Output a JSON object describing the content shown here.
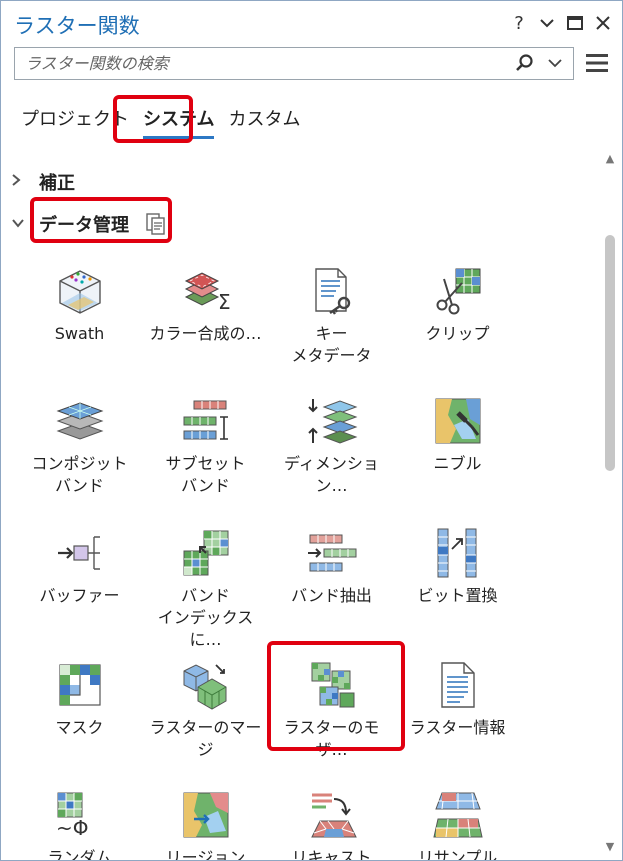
{
  "window": {
    "title": "ラスター関数",
    "help": "?",
    "collapse": "⌄",
    "maximize": "▭",
    "close": "✕"
  },
  "search": {
    "placeholder": "ラスター関数の検索"
  },
  "tabs": [
    {
      "label": "プロジェクト",
      "active": false
    },
    {
      "label": "システム",
      "active": true
    },
    {
      "label": "カスタム",
      "active": false
    }
  ],
  "groups": [
    {
      "label": "補正",
      "expanded": false
    },
    {
      "label": "データ管理",
      "expanded": true
    }
  ],
  "items": [
    {
      "label": "Swath",
      "icon": "swath-icon"
    },
    {
      "label": "カラー合成の…",
      "icon": "color-composite-icon"
    },
    {
      "label": "キー\nメタデータ",
      "icon": "key-metadata-icon"
    },
    {
      "label": "クリップ",
      "icon": "clip-icon"
    },
    {
      "label": "コンポジット\nバンド",
      "icon": "composite-bands-icon"
    },
    {
      "label": "サブセット\nバンド",
      "icon": "subset-bands-icon"
    },
    {
      "label": "ディメンション…",
      "icon": "dimension-icon"
    },
    {
      "label": "ニブル",
      "icon": "nibble-icon"
    },
    {
      "label": "バッファー",
      "icon": "buffer-icon"
    },
    {
      "label": "バンド\nインデックスに…",
      "icon": "band-index-icon"
    },
    {
      "label": "バンド抽出",
      "icon": "extract-bands-icon"
    },
    {
      "label": "ビット置換",
      "icon": "bit-replace-icon"
    },
    {
      "label": "マスク",
      "icon": "mask-icon"
    },
    {
      "label": "ラスターのマージ",
      "icon": "merge-rasters-icon"
    },
    {
      "label": "ラスターのモザ…",
      "icon": "mosaic-rasters-icon"
    },
    {
      "label": "ラスター情報",
      "icon": "raster-info-icon"
    },
    {
      "label": "ランダム",
      "icon": "random-icon"
    },
    {
      "label": "リージョン",
      "icon": "region-icon"
    },
    {
      "label": "リキャスト",
      "icon": "recast-icon"
    },
    {
      "label": "リサンプル",
      "icon": "resample-icon"
    }
  ]
}
